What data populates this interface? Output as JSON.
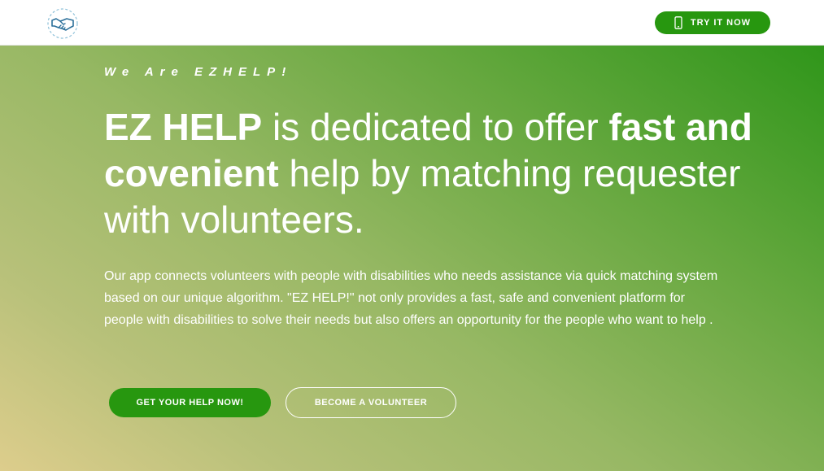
{
  "header": {
    "logo_icon": "handshake-icon",
    "try_button": {
      "label": "TRY IT NOW",
      "icon": "phone-icon"
    }
  },
  "hero": {
    "tagline": "We Are EZHELP!",
    "headline": {
      "part1_bold": "EZ HELP",
      "part2": " is dedicated to offer ",
      "part3_bold": "fast and covenient",
      "part4": " help by matching requester with volunteers."
    },
    "description": "Our app connects volunteers with people with disabilities who needs assistance via quick matching system based on our unique algorithm.  \"EZ HELP!\" not only provides a fast, safe and convenient platform for people with disabilities to solve their needs but also offers an opportunity for the people who want to help .",
    "primary_button": "GET YOUR HELP NOW!",
    "secondary_button": "BECOME A VOLUNTEER"
  },
  "colors": {
    "brand_green": "#27970f",
    "gradient_start": "#ddcd8c",
    "gradient_end": "#2f961a",
    "logo_blue": "#2b6f9a"
  }
}
